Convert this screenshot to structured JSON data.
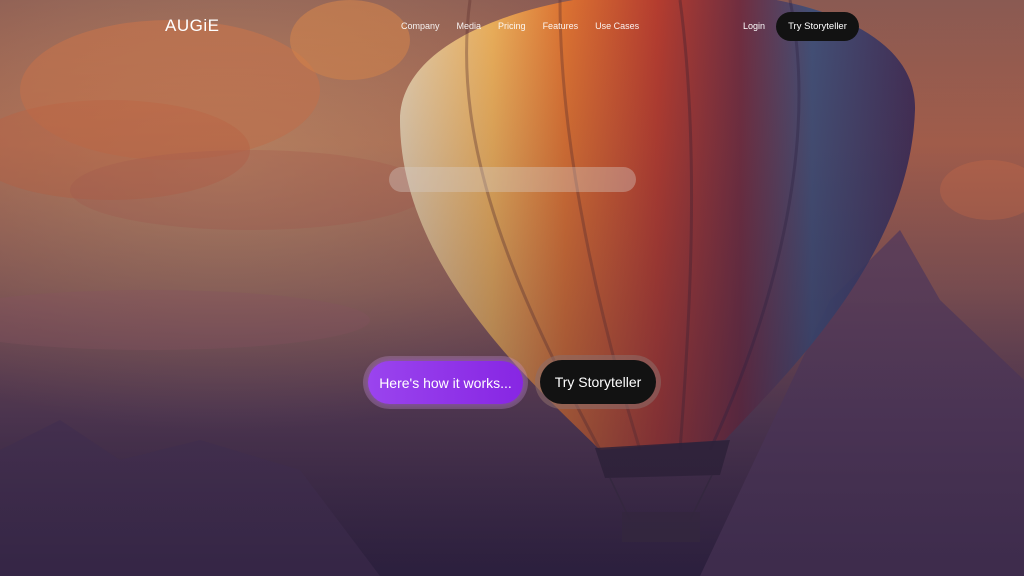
{
  "brand": {
    "logo_text": "AUGiE"
  },
  "nav": {
    "items": [
      {
        "label": "Company"
      },
      {
        "label": "Media"
      },
      {
        "label": "Pricing"
      },
      {
        "label": "Features"
      },
      {
        "label": "Use Cases"
      }
    ],
    "login_label": "Login",
    "cta_label": "Try Storyteller"
  },
  "hero": {
    "primary_button_label": "Here's how it works...",
    "secondary_button_label": "Try Storyteller",
    "background_image": "hot-air-balloon-sunset-illustration"
  },
  "colors": {
    "primary_purple": "#8a2be2",
    "dark_button": "#121212",
    "text": "#ffffff"
  }
}
